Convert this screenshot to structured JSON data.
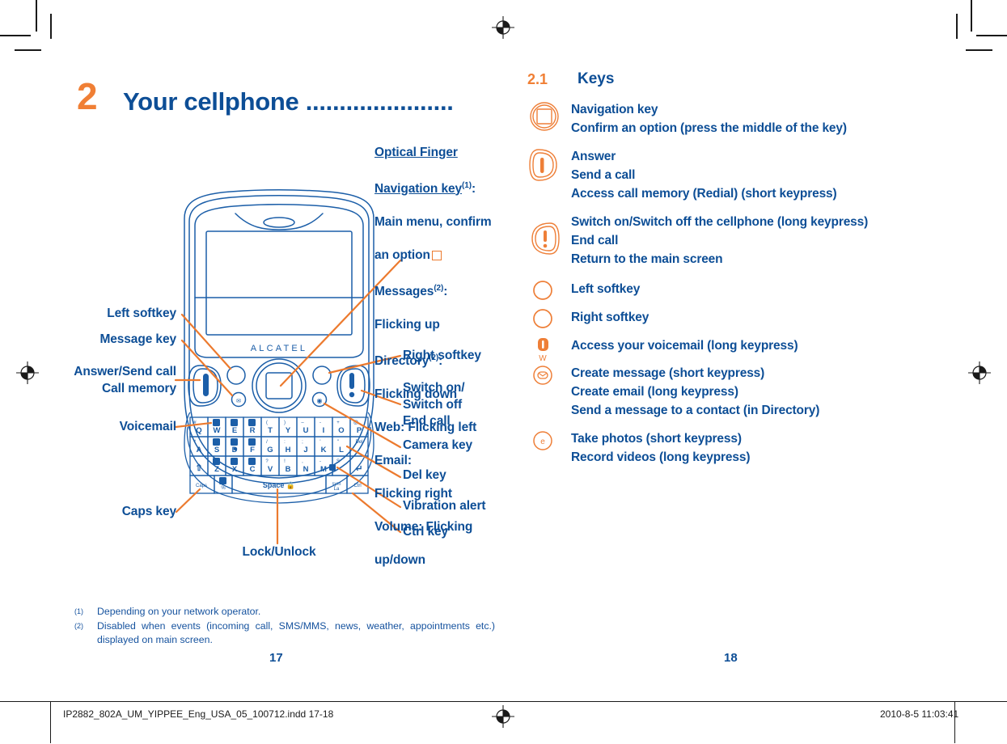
{
  "document": {
    "chapter_number": "2",
    "chapter_title": "Your cellphone ......................",
    "page_left": "17",
    "page_right": "18"
  },
  "diagram": {
    "brand_on_phone": "ALCATEL",
    "callouts_left": [
      {
        "label": "Left softkey"
      },
      {
        "label": "Message key"
      },
      {
        "label": "Answer/Send call\nCall memory"
      },
      {
        "label": "Voicemail"
      },
      {
        "label": "Caps key"
      }
    ],
    "callouts_bottom": [
      {
        "label": "Lock/Unlock"
      }
    ],
    "callouts_right": [
      {
        "label": "Right softkey"
      },
      {
        "label": "Switch on/\nSwitch off\nEnd call"
      },
      {
        "label": "Camera key"
      },
      {
        "label": "Del key"
      },
      {
        "label": "Vibration alert"
      },
      {
        "label": "Ctrl key"
      }
    ],
    "optical_block": {
      "title_line1": "Optical Finger",
      "title_line2": "Navigation key",
      "title_footnote": "(1)",
      "title_colon": ":",
      "line_main_menu": "Main menu, confirm",
      "line_an_option": "an option",
      "line_messages": "Messages",
      "messages_footnote": "(2)",
      "line_flicking_up": "Flicking up",
      "line_directory": "Directory",
      "directory_footnote": "(2)",
      "line_flicking_down": "Flicking down",
      "line_web": "Web: Flicking left",
      "line_email": "Email:",
      "line_flicking_right": "Flicking right",
      "line_volume": "Volume: Flicking",
      "line_updown": "up/down"
    },
    "keyboard_rows": [
      [
        "#Q",
        "W",
        "E",
        "R",
        "(T",
        ")Y",
        "–U",
        "-I",
        "+O",
        "@P"
      ],
      [
        "*A",
        "S",
        "D",
        "F",
        "/G",
        ":H",
        ";J",
        "'K",
        "\"L",
        "Del"
      ],
      [
        "⇧",
        "Z",
        "X",
        "C",
        "?V",
        "!B",
        ",N",
        "-M",
        "S",
        "↵"
      ],
      [
        "Caps",
        "%",
        "Space",
        "sym",
        "Ctrl"
      ]
    ]
  },
  "footnotes": [
    {
      "mark": "(1)",
      "text": "Depending on your network operator."
    },
    {
      "mark": "(2)",
      "text": "Disabled when events (incoming call, SMS/MMS, news, weather, appointments etc.) displayed on main screen."
    }
  ],
  "keys_section": {
    "number": "2.1",
    "title": "Keys",
    "items": [
      {
        "icon": "navigation-key-icon",
        "lines": [
          "Navigation key",
          "Confirm an option (press the middle of the key)"
        ]
      },
      {
        "icon": "send-call-key-icon",
        "lines": [
          "Answer",
          "Send a call",
          "Access call memory (Redial) (short keypress)"
        ]
      },
      {
        "icon": "end-call-key-icon",
        "lines": [
          "Switch on/Switch off the cellphone (long keypress)",
          "End call",
          "Return to the main screen"
        ]
      },
      {
        "icon": "left-softkey-icon",
        "lines": [
          "Left softkey"
        ]
      },
      {
        "icon": "right-softkey-icon",
        "lines": [
          "Right softkey"
        ]
      },
      {
        "icon": "voicemail-key-icon",
        "icon_letter": "W",
        "lines": [
          "Access your voicemail (long keypress)"
        ]
      },
      {
        "icon": "message-key-icon",
        "lines": [
          "Create message (short keypress)",
          "Create email (long keypress)",
          "Send a message to a contact (in Directory)"
        ]
      },
      {
        "icon": "camera-key-icon",
        "lines": [
          "Take photos (short keypress)",
          "Record videos (long keypress)"
        ]
      }
    ]
  },
  "print_bar": {
    "file_name": "IP2882_802A_UM_YIPPEE_Eng_USA_05_100712.indd   17-18",
    "timestamp": "2010-8-5   11:03:41"
  },
  "colors": {
    "accent_orange": "#f07f35",
    "text_blue": "#0d4e96",
    "line_blue": "#1b5ea8",
    "print_black": "#1a1a1a"
  }
}
